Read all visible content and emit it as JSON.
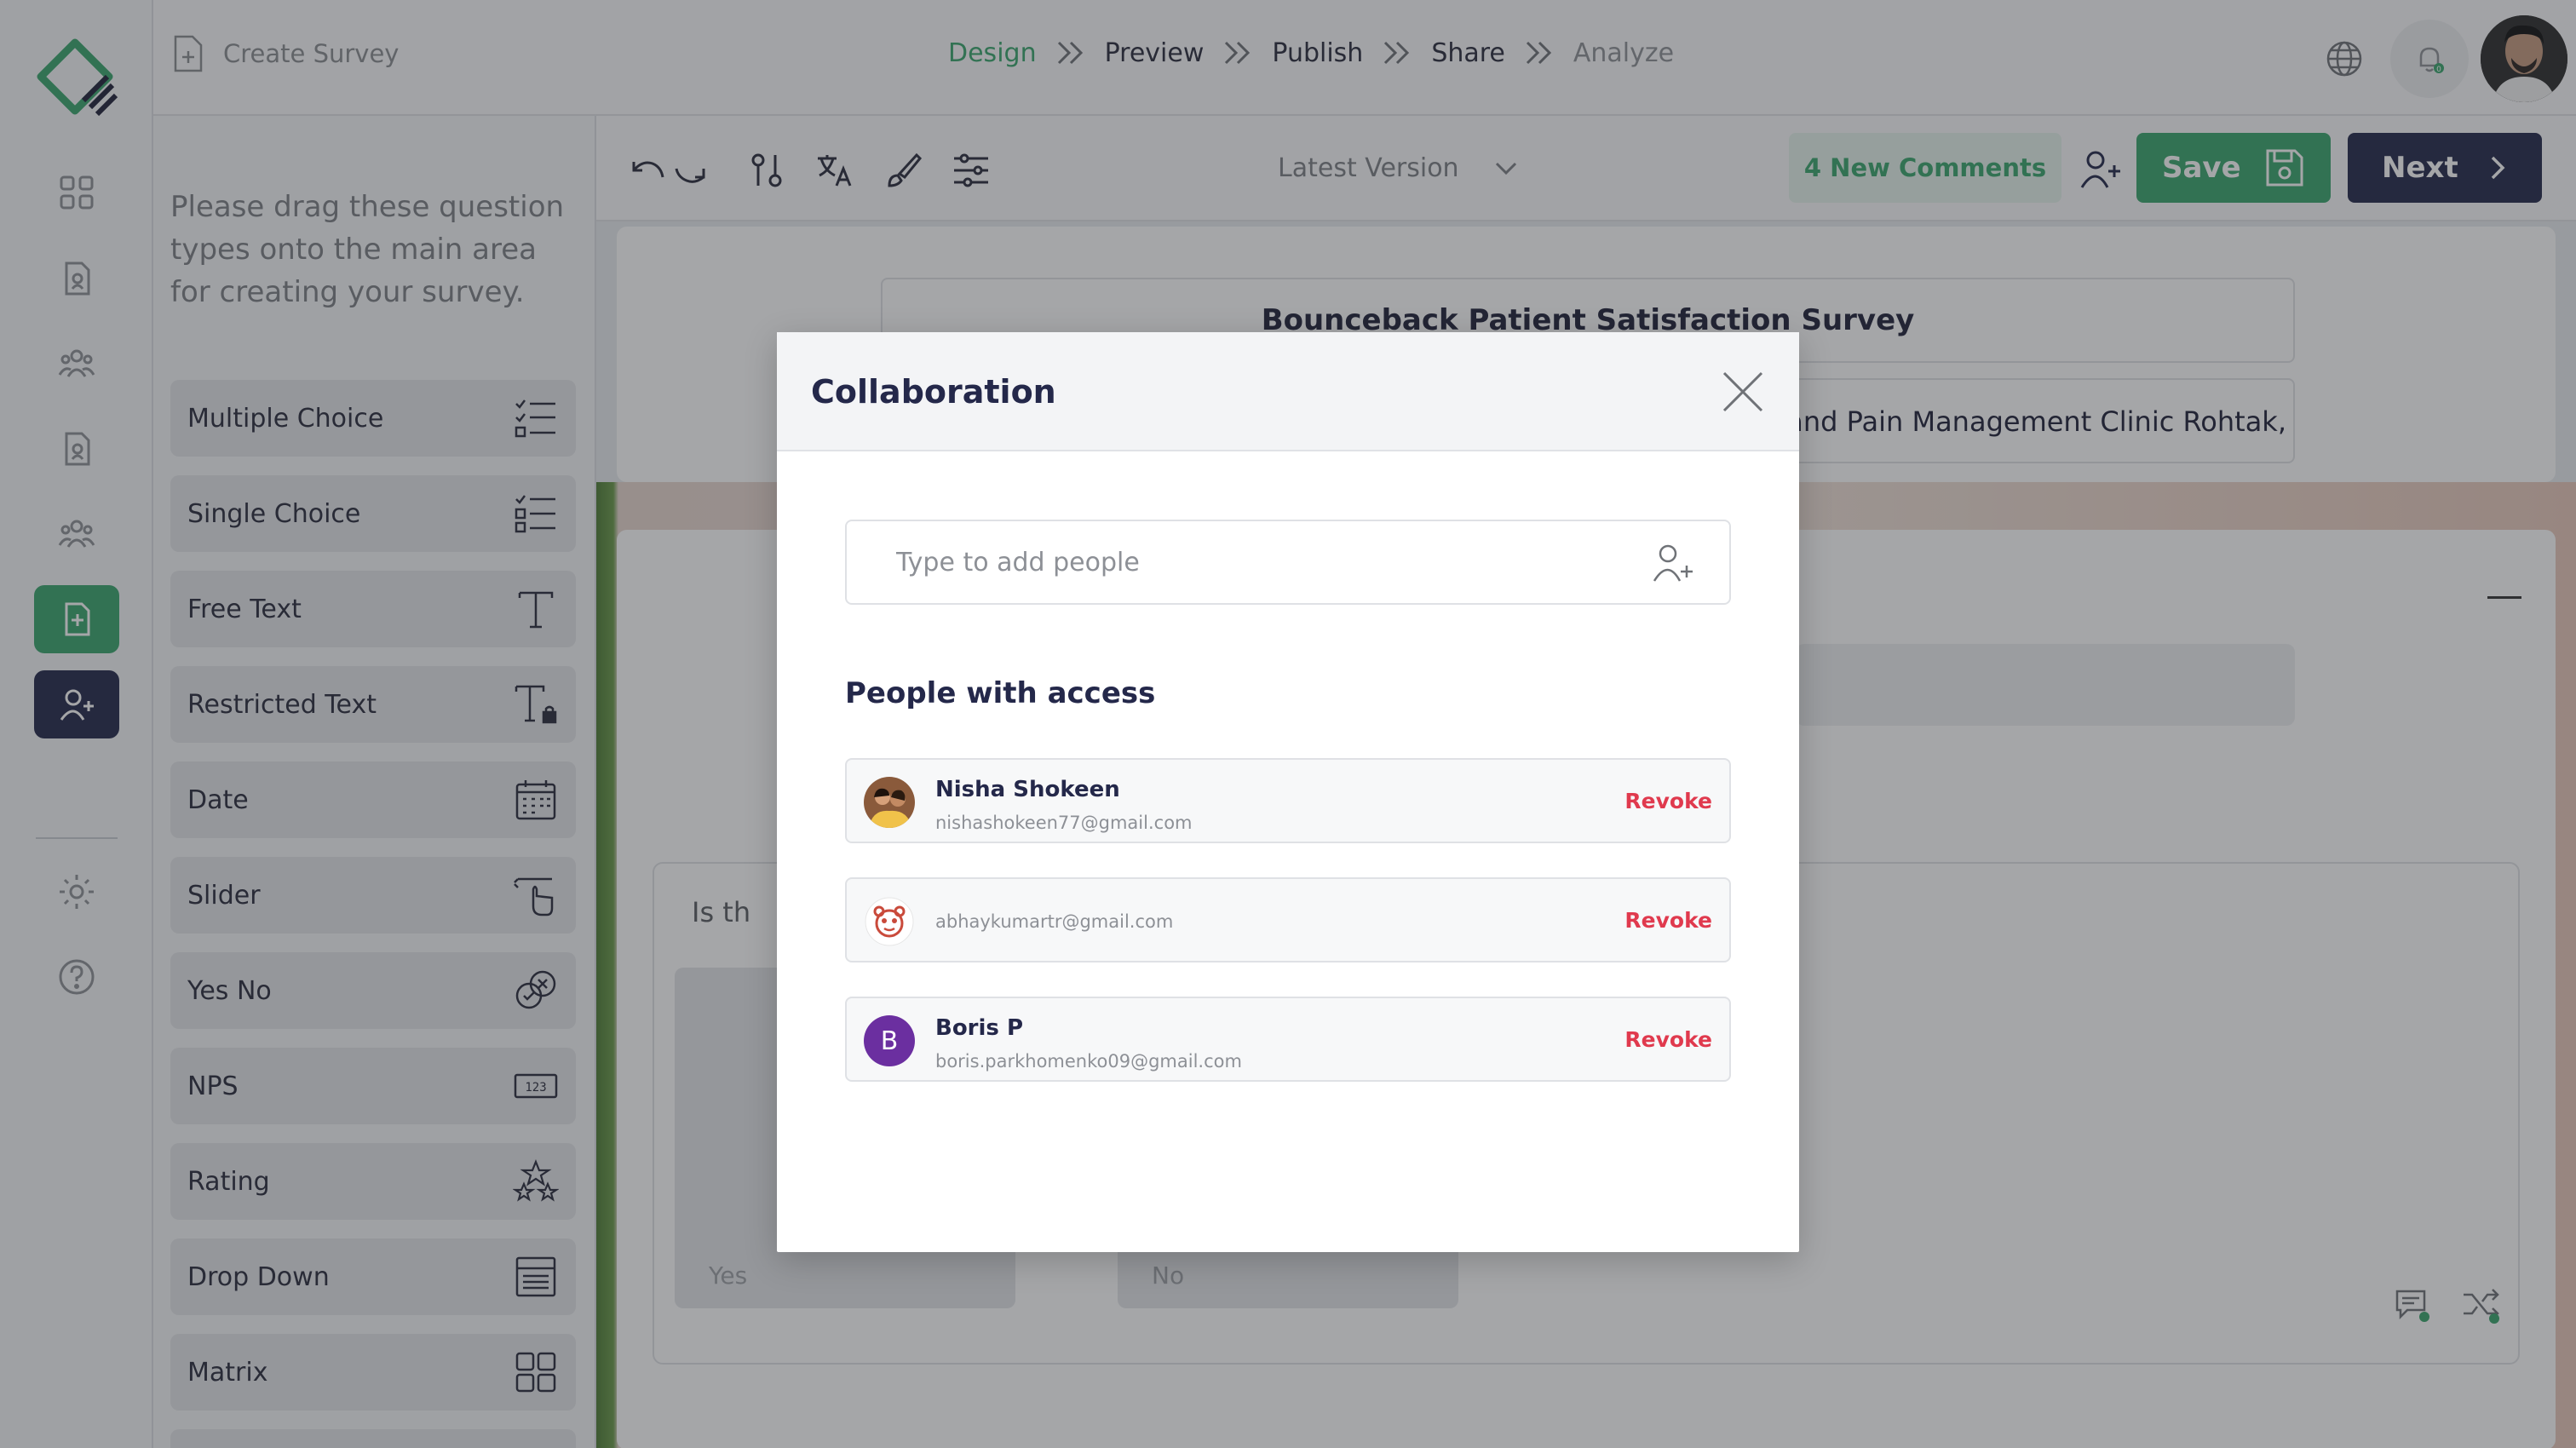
{
  "topbar": {
    "create_survey_label": "Create Survey",
    "steps": [
      {
        "label": "Design",
        "state": "active"
      },
      {
        "label": "Preview",
        "state": "normal"
      },
      {
        "label": "Publish",
        "state": "normal"
      },
      {
        "label": "Share",
        "state": "normal"
      },
      {
        "label": "Analyze",
        "state": "muted"
      }
    ],
    "notification_count": "0"
  },
  "rail": {
    "items": [
      "dashboard-icon",
      "survey-doc-icon",
      "users-icon",
      "survey-doc-icon",
      "users-icon",
      "create-survey-icon",
      "add-collaborator-icon",
      "settings-icon",
      "help-icon"
    ],
    "active_color": "#3aa66d",
    "selected_color": "#24284a"
  },
  "palette": {
    "hint": "Please drag these question types onto the main area for creating your survey.",
    "items": [
      {
        "label": "Multiple Choice",
        "icon": "checklist-icon"
      },
      {
        "label": "Single Choice",
        "icon": "single-choice-icon"
      },
      {
        "label": "Free Text",
        "icon": "text-icon"
      },
      {
        "label": "Restricted Text",
        "icon": "restricted-text-icon"
      },
      {
        "label": "Date",
        "icon": "calendar-icon"
      },
      {
        "label": "Slider",
        "icon": "slider-touch-icon"
      },
      {
        "label": "Yes No",
        "icon": "yes-no-icon"
      },
      {
        "label": "NPS",
        "icon": "nps-icon"
      },
      {
        "label": "Rating",
        "icon": "stars-icon"
      },
      {
        "label": "Drop Down",
        "icon": "dropdown-icon"
      },
      {
        "label": "Matrix",
        "icon": "matrix-icon"
      }
    ]
  },
  "toolbar": {
    "version_label": "Latest Version",
    "comments_label": "4 New Comments",
    "save_label": "Save",
    "next_label": "Next"
  },
  "survey": {
    "title": "Bounceback Patient Satisfaction Survey",
    "description_visible": "and Pain Management Clinic Rohtak,",
    "question_visible": "Is th",
    "options": [
      "Yes",
      "No"
    ]
  },
  "modal": {
    "title": "Collaboration",
    "input_placeholder": "Type to add people",
    "access_title": "People with access",
    "people": [
      {
        "name": "Nisha Shokeen",
        "email": "nishashokeen77@gmail.com",
        "action": "Revoke"
      },
      {
        "name": "",
        "email": "abhaykumartr@gmail.com",
        "action": "Revoke"
      },
      {
        "name": "Boris P",
        "email": "boris.parkhomenko09@gmail.com",
        "initial": "B",
        "action": "Revoke"
      }
    ]
  },
  "colors": {
    "accent_green": "#3aa66d",
    "navy": "#24284a",
    "revoke_red": "#e03a4e",
    "avatar_purple": "#6b2fa0"
  }
}
